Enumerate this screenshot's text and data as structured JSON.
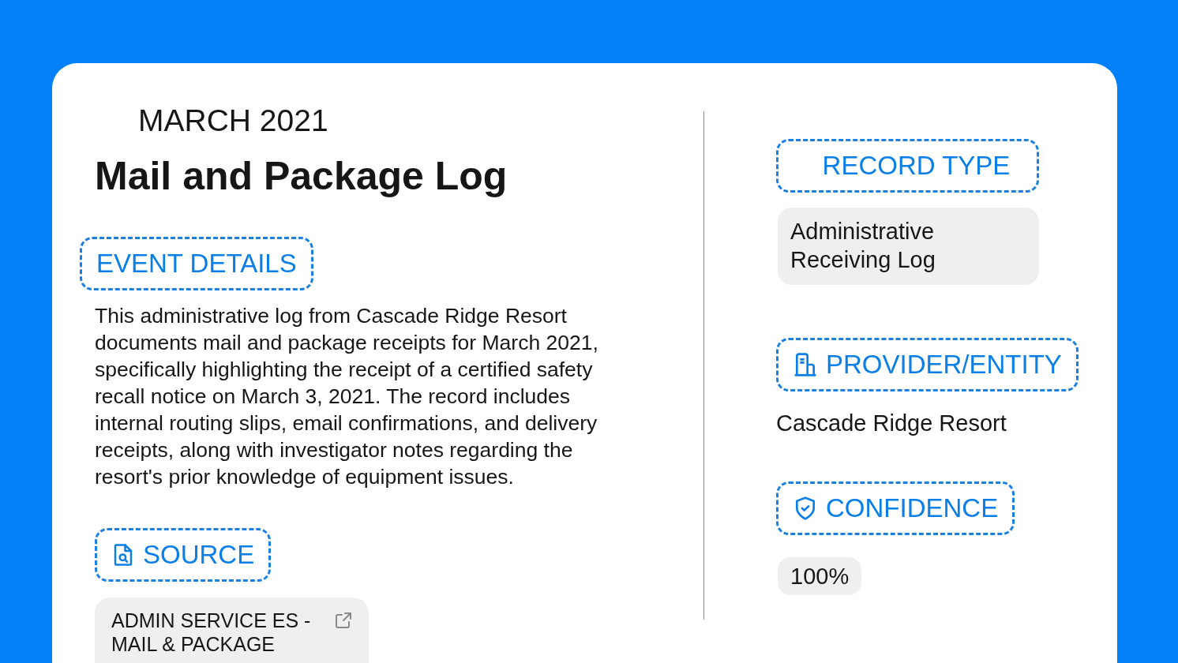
{
  "period": "MARCH 2021",
  "title": "Mail and Package Log",
  "event_details": {
    "heading": "EVENT DETAILS",
    "text": "This administrative log from Cascade Ridge Resort documents mail and package receipts for March 2021, specifically highlighting the receipt of a certified safety recall notice on March 3, 2021. The record includes internal routing slips, email confirmations, and delivery receipts, along with investigator notes regarding the resort's prior knowledge of equipment issues."
  },
  "source": {
    "heading": "SOURCE",
    "document": "ADMIN SERVICE ES - MAIL & PACKAGE"
  },
  "record_type": {
    "heading": "RECORD TYPE",
    "value": "Administrative Receiving Log"
  },
  "provider_entity": {
    "heading": "PROVIDER/ENTITY",
    "value": "Cascade Ridge Resort"
  },
  "confidence": {
    "heading": "CONFIDENCE",
    "value": "100%"
  }
}
